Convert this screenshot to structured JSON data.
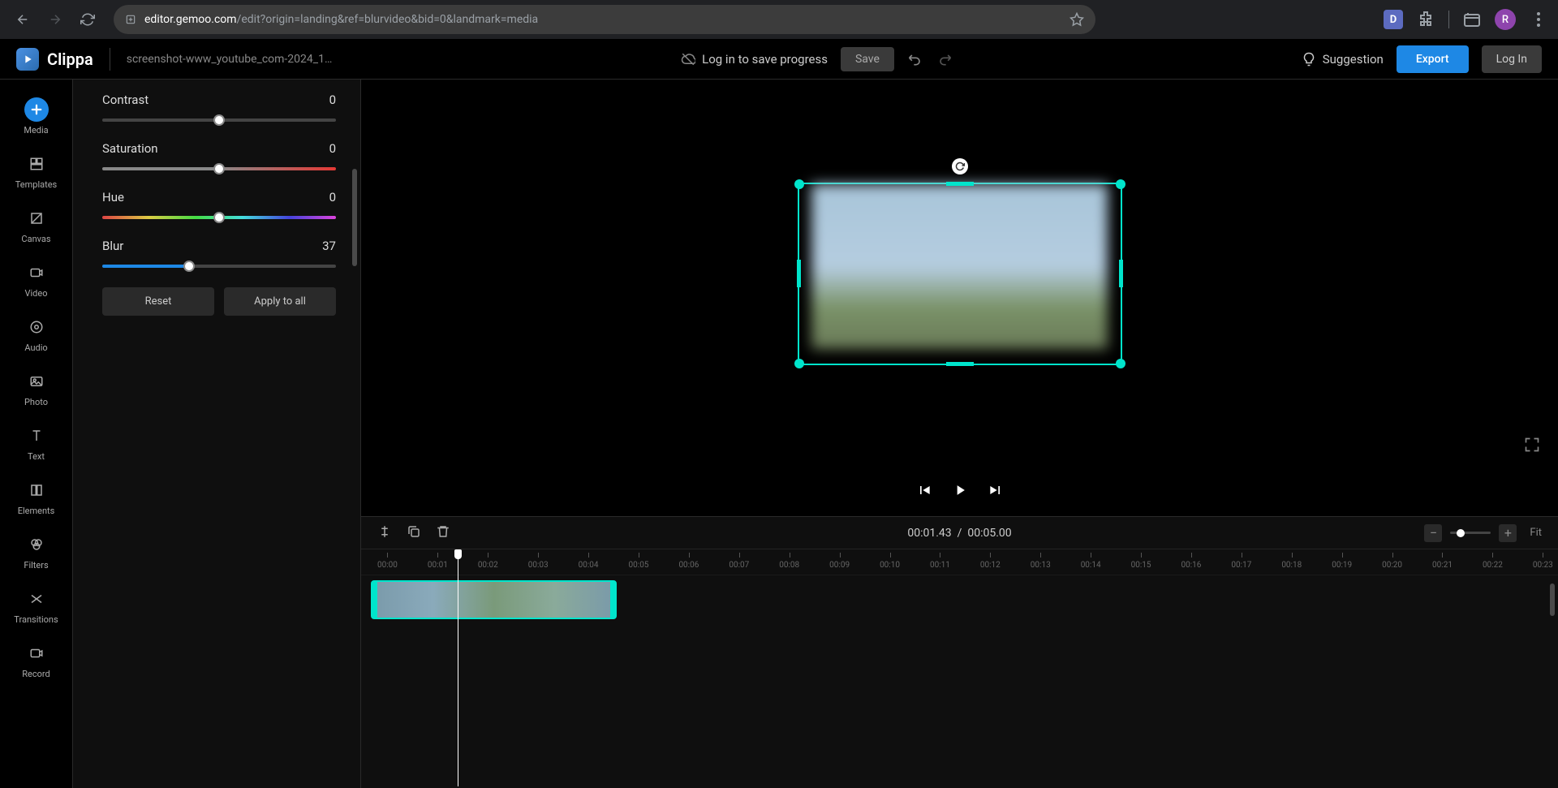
{
  "browser": {
    "url_domain": "editor.gemoo.com",
    "url_path": "/edit?origin=landing&ref=blurvideo&bid=0&landmark=media",
    "avatar_letter": "R"
  },
  "header": {
    "app_name": "Clippa",
    "project_name": "screenshot-www_youtube_com-2024_1…",
    "login_prompt": "Log in to save progress",
    "save_label": "Save",
    "suggestion_label": "Suggestion",
    "export_label": "Export",
    "login_label": "Log In"
  },
  "sidebar": {
    "items": [
      {
        "label": "Media",
        "icon": "plus",
        "active": true
      },
      {
        "label": "Templates",
        "icon": "templates"
      },
      {
        "label": "Canvas",
        "icon": "canvas"
      },
      {
        "label": "Video",
        "icon": "video"
      },
      {
        "label": "Audio",
        "icon": "audio"
      },
      {
        "label": "Photo",
        "icon": "photo"
      },
      {
        "label": "Text",
        "icon": "text"
      },
      {
        "label": "Elements",
        "icon": "elements"
      },
      {
        "label": "Filters",
        "icon": "filters"
      },
      {
        "label": "Transitions",
        "icon": "transitions"
      },
      {
        "label": "Record",
        "icon": "record"
      }
    ]
  },
  "properties": {
    "contrast": {
      "label": "Contrast",
      "value": "0",
      "thumb_pct": 50
    },
    "saturation": {
      "label": "Saturation",
      "value": "0",
      "thumb_pct": 50
    },
    "hue": {
      "label": "Hue",
      "value": "0",
      "thumb_pct": 50
    },
    "blur": {
      "label": "Blur",
      "value": "37",
      "thumb_pct": 37
    },
    "reset_label": "Reset",
    "apply_all_label": "Apply to all"
  },
  "timeline": {
    "current_time": "00:01.43",
    "separator": "/",
    "total_time": "00:05.00",
    "fit_label": "Fit",
    "marks": [
      "00:00",
      "00:01",
      "00:02",
      "00:03",
      "00:04",
      "00:05",
      "00:06",
      "00:07",
      "00:08",
      "00:09",
      "00:10",
      "00:11",
      "00:12",
      "00:13",
      "00:14",
      "00:15",
      "00:16",
      "00:17",
      "00:18",
      "00:19",
      "00:20",
      "00:21",
      "00:22",
      "00:23"
    ]
  }
}
